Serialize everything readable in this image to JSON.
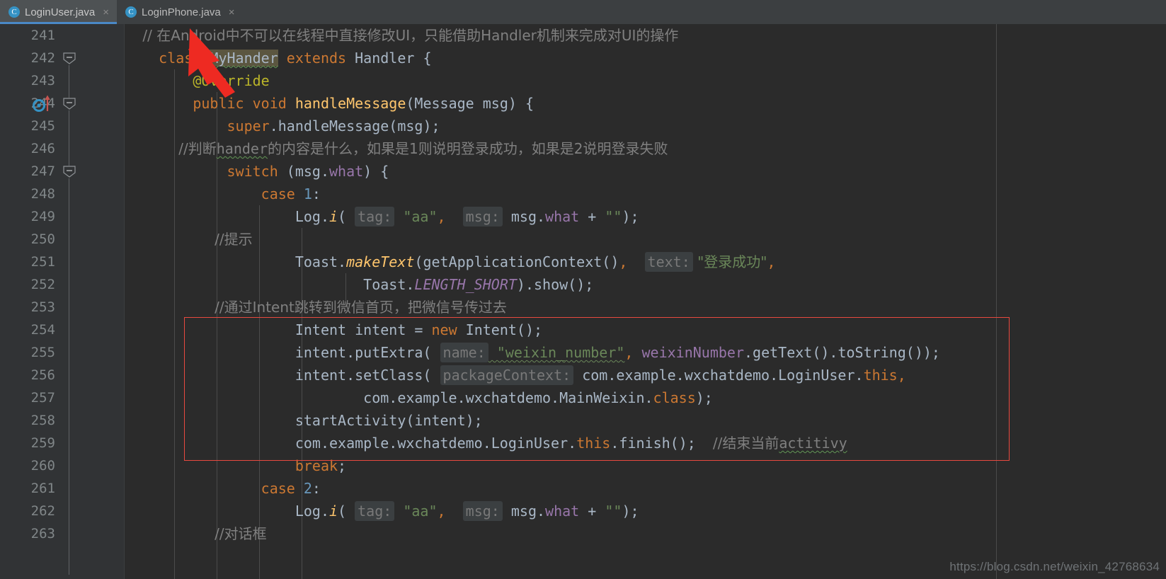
{
  "window": {
    "background": "#2b2b2b",
    "accent": "#4a88c7"
  },
  "tabs": [
    {
      "label": "LoginUser.java",
      "icon": "java-class-icon",
      "icon_letter": "C",
      "close_glyph": "×",
      "active": true
    },
    {
      "label": "LoginPhone.java",
      "icon": "java-class-icon",
      "icon_letter": "C",
      "close_glyph": "×",
      "active": false
    }
  ],
  "editor": {
    "first_line_number": 241,
    "last_line_number": 263,
    "line_numbers": [
      "241",
      "242",
      "243",
      "244",
      "245",
      "246",
      "247",
      "248",
      "249",
      "250",
      "251",
      "252",
      "253",
      "254",
      "255",
      "256",
      "257",
      "258",
      "259",
      "260",
      "261",
      "262",
      "263"
    ],
    "gutter_icons": [
      {
        "line": "244",
        "name": "implementing-method-icon",
        "description": "overrides method marker"
      }
    ],
    "fold_markers": [
      "242",
      "244",
      "247"
    ],
    "lines": [
      {
        "n": "241",
        "text": "    // 在Android中不可以在线程中直接修改UI，只能借助Handler机制来完成对UI的操作"
      },
      {
        "n": "242",
        "text": "    class MyHander extends Handler {"
      },
      {
        "n": "243",
        "text": "        @Override"
      },
      {
        "n": "244",
        "text": "        public void handleMessage(Message msg) {"
      },
      {
        "n": "245",
        "text": "            super.handleMessage(msg);"
      },
      {
        "n": "246",
        "text": "            //判断hander的内容是什么，如果是1则说明登录成功，如果是2说明登录失败"
      },
      {
        "n": "247",
        "text": "            switch (msg.what) {"
      },
      {
        "n": "248",
        "text": "                case 1:"
      },
      {
        "n": "249",
        "text": "                    Log.i( tag: \"aa\",  msg: msg.what + \"\");"
      },
      {
        "n": "250",
        "text": "                    //提示"
      },
      {
        "n": "251",
        "text": "                    Toast.makeText(getApplicationContext(),  text: \"登录成功\","
      },
      {
        "n": "252",
        "text": "                            Toast.LENGTH_SHORT).show();"
      },
      {
        "n": "253",
        "text": "                    //通过Intent跳转到微信首页，把微信号传过去"
      },
      {
        "n": "254",
        "text": "                    Intent intent = new Intent();"
      },
      {
        "n": "255",
        "text": "                    intent.putExtra( name: \"weixin_number\", weixinNumber.getText().toString());"
      },
      {
        "n": "256",
        "text": "                    intent.setClass( packageContext: com.example.wxchatdemo.LoginUser.this,"
      },
      {
        "n": "257",
        "text": "                            com.example.wxchatdemo.MainWeixin.class);"
      },
      {
        "n": "258",
        "text": "                    startActivity(intent);"
      },
      {
        "n": "259",
        "text": "                    com.example.wxchatdemo.LoginUser.this.finish();  //结束当前actitivy"
      },
      {
        "n": "260",
        "text": "                    break;"
      },
      {
        "n": "261",
        "text": "                case 2:"
      },
      {
        "n": "262",
        "text": "                    Log.i( tag: \"aa\",  msg: msg.what + \"\");"
      },
      {
        "n": "263",
        "text": "                    //对话框"
      }
    ],
    "parameter_hints": [
      "tag:",
      "msg:",
      "text:",
      "name:",
      "packageContext:"
    ],
    "highlighted_identifier": "MyHander",
    "colors": {
      "keyword": "#cc7832",
      "string": "#6a8759",
      "comment": "#808080",
      "number": "#6897bb",
      "method": "#ffc66d",
      "field": "#9876aa",
      "annotation": "#bbb529",
      "default_text": "#a9b7c6",
      "gutter_bg": "#313335",
      "editor_bg": "#2b2b2b"
    }
  },
  "annotations": {
    "red_box": {
      "name": "red-highlight-box",
      "color": "#e8493f",
      "covers_lines": "254-259"
    },
    "red_arrow": {
      "name": "red-arrow-cursor",
      "color": "#ee2a22",
      "points_to": "MyHander"
    }
  },
  "watermark": {
    "text": "https://blog.csdn.net/weixin_42768634"
  }
}
